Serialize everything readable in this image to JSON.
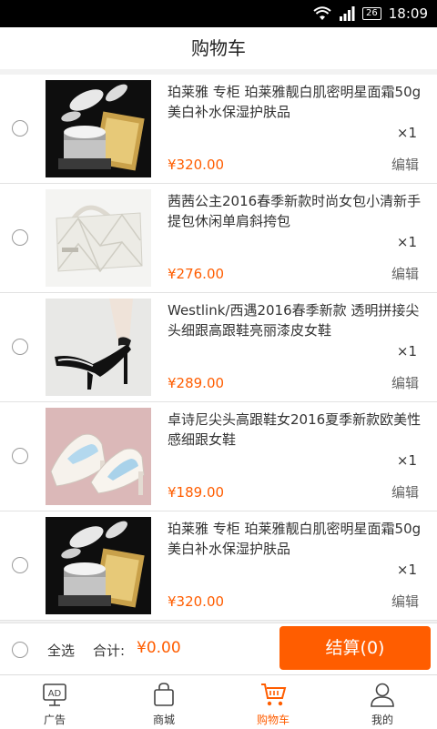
{
  "status": {
    "battery": "26",
    "time": "18:09"
  },
  "header": {
    "title": "购物车"
  },
  "items": [
    {
      "title": "珀莱雅 专柜 珀莱雅靓白肌密明星面霜50g 美白补水保湿护肤品",
      "qty": "×1",
      "price": "¥320.00",
      "edit": "编辑"
    },
    {
      "title": "茜茜公主2016春季新款时尚女包小清新手提包休闲单肩斜挎包",
      "qty": "×1",
      "price": "¥276.00",
      "edit": "编辑"
    },
    {
      "title": "Westlink/西遇2016春季新款 透明拼接尖头细跟高跟鞋亮丽漆皮女鞋",
      "qty": "×1",
      "price": "¥289.00",
      "edit": "编辑"
    },
    {
      "title": "卓诗尼尖头高跟鞋女2016夏季新款欧美性感细跟女鞋",
      "qty": "×1",
      "price": "¥189.00",
      "edit": "编辑"
    },
    {
      "title": "珀莱雅 专柜 珀莱雅靓白肌密明星面霜50g 美白补水保湿护肤品",
      "qty": "×1",
      "price": "¥320.00",
      "edit": "编辑"
    }
  ],
  "footer": {
    "select_all": "全选",
    "total_label": "合计:",
    "total_value": "¥0.00",
    "checkout": "结算(0)"
  },
  "tabs": [
    {
      "label": "广告",
      "icon": "ad-icon"
    },
    {
      "label": "商城",
      "icon": "shopping-bag-icon"
    },
    {
      "label": "购物车",
      "icon": "cart-icon",
      "active": true
    },
    {
      "label": "我的",
      "icon": "user-icon"
    }
  ],
  "colors": {
    "accent": "#ff5d00"
  }
}
